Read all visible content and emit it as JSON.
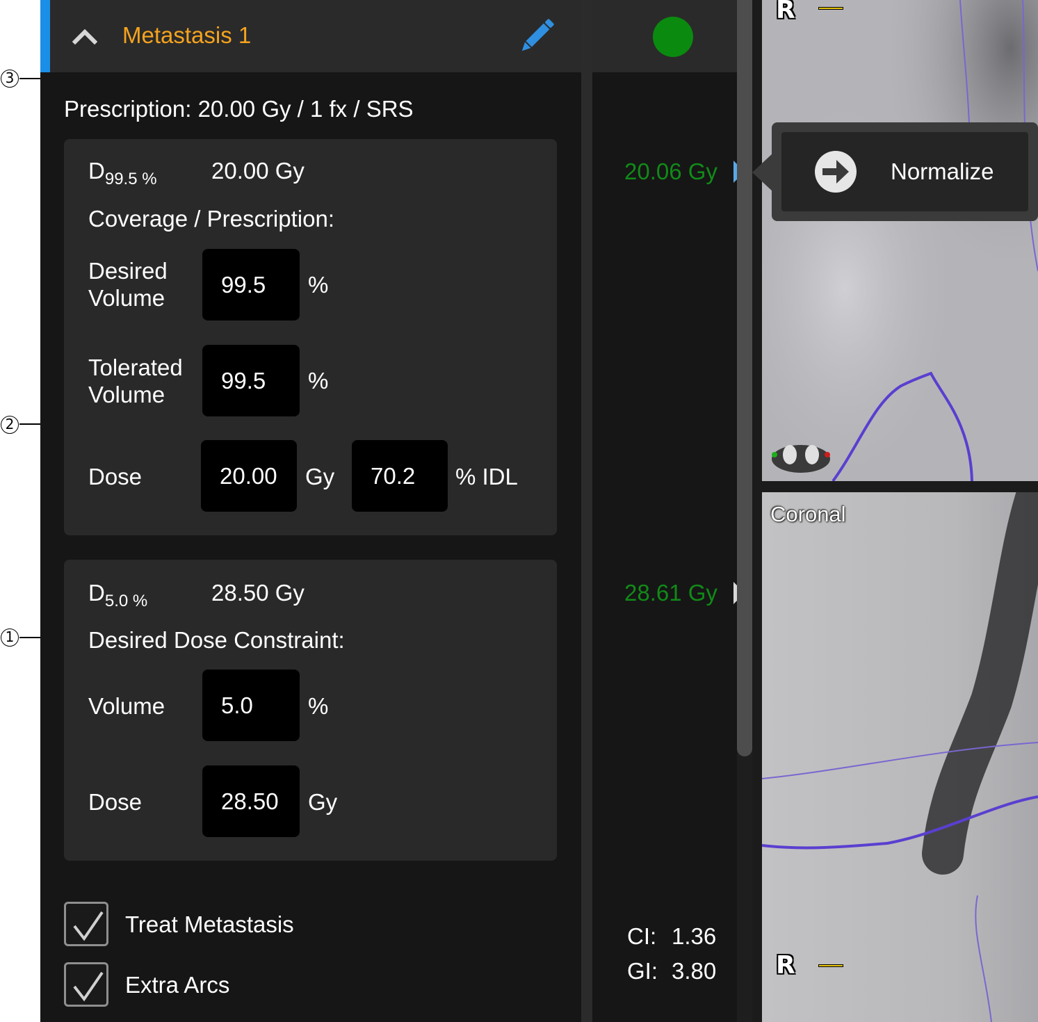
{
  "structure": {
    "title": "Metastasis 1",
    "prescription": "Prescription: 20.00 Gy / 1 fx / SRS"
  },
  "coverage": {
    "metric_main": "D",
    "metric_sub": "99.5 %",
    "metric_value": "20.00 Gy",
    "heading": "Coverage / Prescription:",
    "desired_volume_label_1": "Desired",
    "desired_volume_label_2": "Volume",
    "desired_volume_value": "99.5",
    "desired_volume_unit": "%",
    "tolerated_volume_label_1": "Tolerated",
    "tolerated_volume_label_2": "Volume",
    "tolerated_volume_value": "99.5",
    "tolerated_volume_unit": "%",
    "dose_label": "Dose",
    "dose_value": "20.00",
    "dose_unit": "Gy",
    "idl_value": "70.2",
    "idl_unit": "% IDL"
  },
  "constraint": {
    "metric_main": "D",
    "metric_sub": "5.0 %",
    "metric_value": "28.50 Gy",
    "heading": "Desired Dose Constraint:",
    "volume_label": "Volume",
    "volume_value": "5.0",
    "volume_unit": "%",
    "dose_label": "Dose",
    "dose_value": "28.50",
    "dose_unit": "Gy"
  },
  "options": {
    "treat_label": "Treat Metastasis",
    "treat_checked": true,
    "extra_arcs_label": "Extra Arcs",
    "extra_arcs_checked": true
  },
  "results": {
    "coverage_achieved": "20.06 Gy",
    "constraint_achieved": "28.61 Gy",
    "ci_label": "CI:",
    "ci_value": "1.36",
    "gi_label": "GI:",
    "gi_value": "3.80",
    "status_color": "#0b8a10"
  },
  "tooltip": {
    "label": "Normalize",
    "icon": "arrow-right-circle-icon"
  },
  "viewers": {
    "bottom_label": "Coronal",
    "orientation_top": "R",
    "orientation_bottom": "R"
  },
  "callouts": {
    "one": "1",
    "two": "2",
    "three": "3"
  },
  "colors": {
    "accent": "#1b8ee8",
    "title": "#f5a31e",
    "achieved": "#118a18",
    "contour": "#5a3fd0"
  }
}
